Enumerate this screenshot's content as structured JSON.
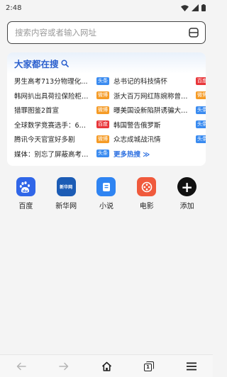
{
  "status_bar": {
    "time": "2:48",
    "icons": [
      "wifi-icon",
      "signal-icon",
      "battery-icon"
    ]
  },
  "search": {
    "placeholder": "搜索内容或者输入网址",
    "value": "",
    "scan_icon": "scan-icon"
  },
  "hot": {
    "title": "大家都在搜",
    "more_label": "更多热搜 ≫",
    "colors": {
      "blue": "#3a8bf0",
      "orange": "#f59b26",
      "red": "#e8363a"
    },
    "items": [
      {
        "text": "男生高考713分物理化…",
        "badge": "头条",
        "badge_color": "blue"
      },
      {
        "text": "总书记的科技情怀",
        "badge": "百度",
        "badge_color": "red"
      },
      {
        "text": "韩网扒出具荷拉保险柜…",
        "badge": "微博",
        "badge_color": "orange"
      },
      {
        "text": "浙大百万网红陈婉称曾…",
        "badge": "微博",
        "badge_color": "orange"
      },
      {
        "text": "猎罪图鉴2首宣",
        "badge": "微博",
        "badge_color": "orange"
      },
      {
        "text": "曝美国设新陷阱诱骗大…",
        "badge": "头条",
        "badge_color": "blue"
      },
      {
        "text": "全球数学竞赛选手：6…",
        "badge": "百度",
        "badge_color": "red"
      },
      {
        "text": "韩国警告俄罗斯",
        "badge": "头条",
        "badge_color": "blue"
      },
      {
        "text": "腾讯今天官宣好多剧",
        "badge": "微博",
        "badge_color": "orange"
      },
      {
        "text": "众志成城战汛情",
        "badge": "头条",
        "badge_color": "blue"
      },
      {
        "text": "媒体：别忘了屏蔽高考…",
        "badge": "头条",
        "badge_color": "blue"
      }
    ]
  },
  "shortcuts": [
    {
      "label": "百度",
      "icon": "baidu-icon",
      "color": "#3066e8",
      "glyph": "du"
    },
    {
      "label": "新华网",
      "icon": "xinhua-icon",
      "color": "#1c5cb5",
      "glyph": "新华网"
    },
    {
      "label": "小说",
      "icon": "novel-icon",
      "color": "#2f84f2",
      "glyph": ""
    },
    {
      "label": "电影",
      "icon": "film-icon",
      "color": "#f05a3c",
      "glyph": ""
    },
    {
      "label": "添加",
      "icon": "add-icon",
      "color": "#111111",
      "glyph": "+"
    }
  ],
  "bottom_nav": {
    "items": [
      "back-icon",
      "forward-icon",
      "home-icon",
      "tabs-icon",
      "menu-icon"
    ],
    "tab_count": "1"
  }
}
